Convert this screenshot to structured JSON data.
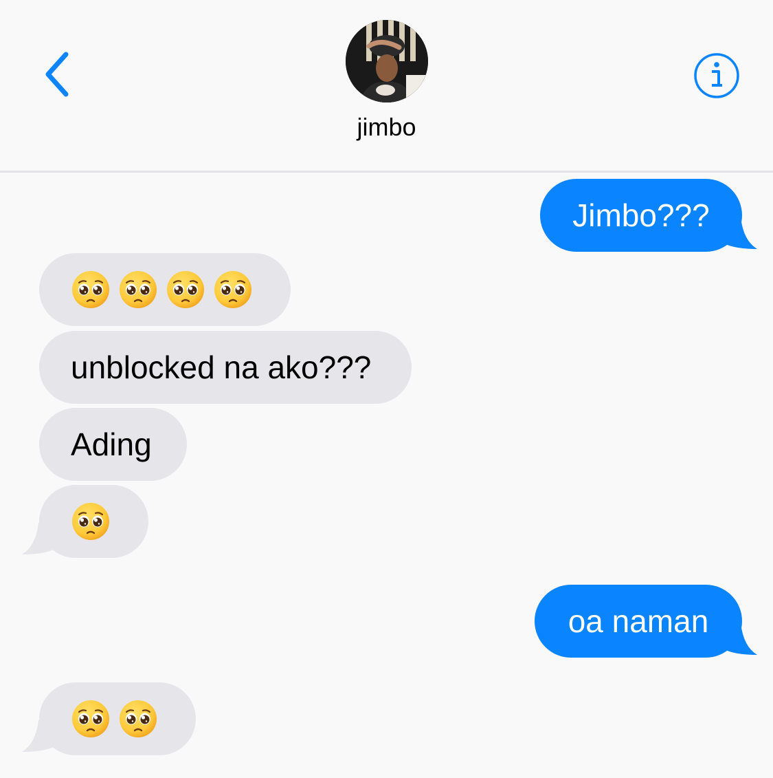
{
  "header": {
    "contact_name": "jimbo",
    "back_icon": "chevron-left-icon",
    "info_icon": "info-circle-icon",
    "accent_color": "#0a84ff"
  },
  "messages": [
    {
      "direction": "outgoing",
      "text": "Jimbo???"
    },
    {
      "direction": "incoming",
      "emoji": "pleading-face",
      "emoji_count": 4
    },
    {
      "direction": "incoming",
      "text": "unblocked na ako???"
    },
    {
      "direction": "incoming",
      "text": "Ading"
    },
    {
      "direction": "incoming",
      "emoji": "pleading-face",
      "emoji_count": 1
    },
    {
      "direction": "outgoing",
      "text": "oa naman"
    },
    {
      "direction": "incoming",
      "emoji": "pleading-face",
      "emoji_count": 2
    }
  ],
  "colors": {
    "outgoing_bubble": "#0a84ff",
    "incoming_bubble": "#e5e5ea",
    "background": "#f9f9f9"
  }
}
